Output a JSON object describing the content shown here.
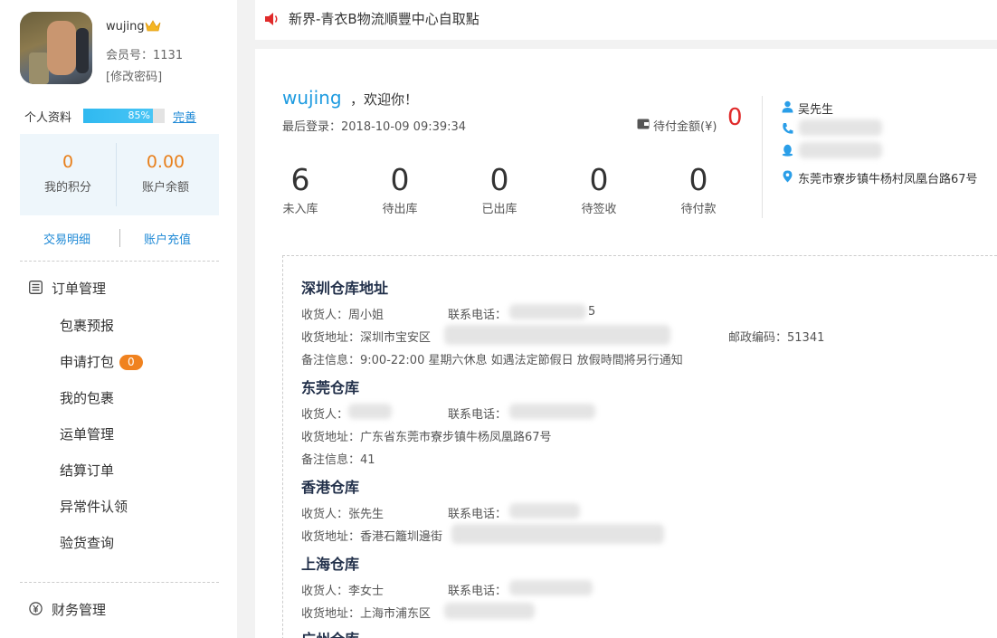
{
  "user": {
    "name": "wujing",
    "member_no": "会员号：1131",
    "change_password": "[修改密码]"
  },
  "profile": {
    "label": "个人资料",
    "percent": "85%",
    "progress": 0.85,
    "complete_link": "完善"
  },
  "stats": {
    "points_value": "0",
    "points_label": "我的积分",
    "balance_value": "0.00",
    "balance_label": "账户余额"
  },
  "links": {
    "transactions": "交易明细",
    "recharge": "账户充值"
  },
  "menu": {
    "orders_title": "订单管理",
    "items": [
      "包裹预报",
      "申请打包",
      "我的包裹",
      "运单管理",
      "结算订单",
      "异常件认领",
      "验货查询"
    ],
    "pack_badge": "0",
    "finance_title": "财务管理"
  },
  "notice": {
    "text": "新界-青衣B物流順豐中心自取點"
  },
  "welcome": {
    "name": "wujing",
    "greeting": "，欢迎你！",
    "last_login": "最后登录：2018-10-09 09:39:34",
    "pending_label": "待付金额(¥)",
    "pending_value": "0"
  },
  "counters": [
    {
      "value": "6",
      "label": "未入库"
    },
    {
      "value": "0",
      "label": "待出库"
    },
    {
      "value": "0",
      "label": "已出库"
    },
    {
      "value": "0",
      "label": "待签收"
    },
    {
      "value": "0",
      "label": "待付款"
    }
  ],
  "contact": {
    "name": "吴先生",
    "address": "东莞市寮步镇牛杨村凤凰台路67号"
  },
  "warehouses": {
    "shenzhen": {
      "title": "深圳仓库地址",
      "receiver": "收货人：周小姐",
      "phone": "联系电话：",
      "phone_tail": "5",
      "address": "收货地址：深圳市宝安区",
      "postcode": "邮政编码：51341",
      "note": "备注信息：9:00-22:00 星期六休息 如遇法定節假日 放假時間將另行通知"
    },
    "dongguan": {
      "title": "东莞仓库",
      "receiver": "收货人：",
      "phone": "联系电话：",
      "address": "收货地址：广东省东莞市寮步镇牛杨凤凰路67号",
      "note": "备注信息：41"
    },
    "hongkong": {
      "title": "香港仓库",
      "receiver": "收货人：张先生",
      "phone": "联系电话：",
      "address": "收货地址：香港石籬圳邊街"
    },
    "shanghai": {
      "title": "上海仓库",
      "receiver": "收货人：李女士",
      "phone": "联系电话：",
      "address": "收货地址：上海市浦东区"
    },
    "guangzhou": {
      "title": "广州仓库"
    }
  }
}
